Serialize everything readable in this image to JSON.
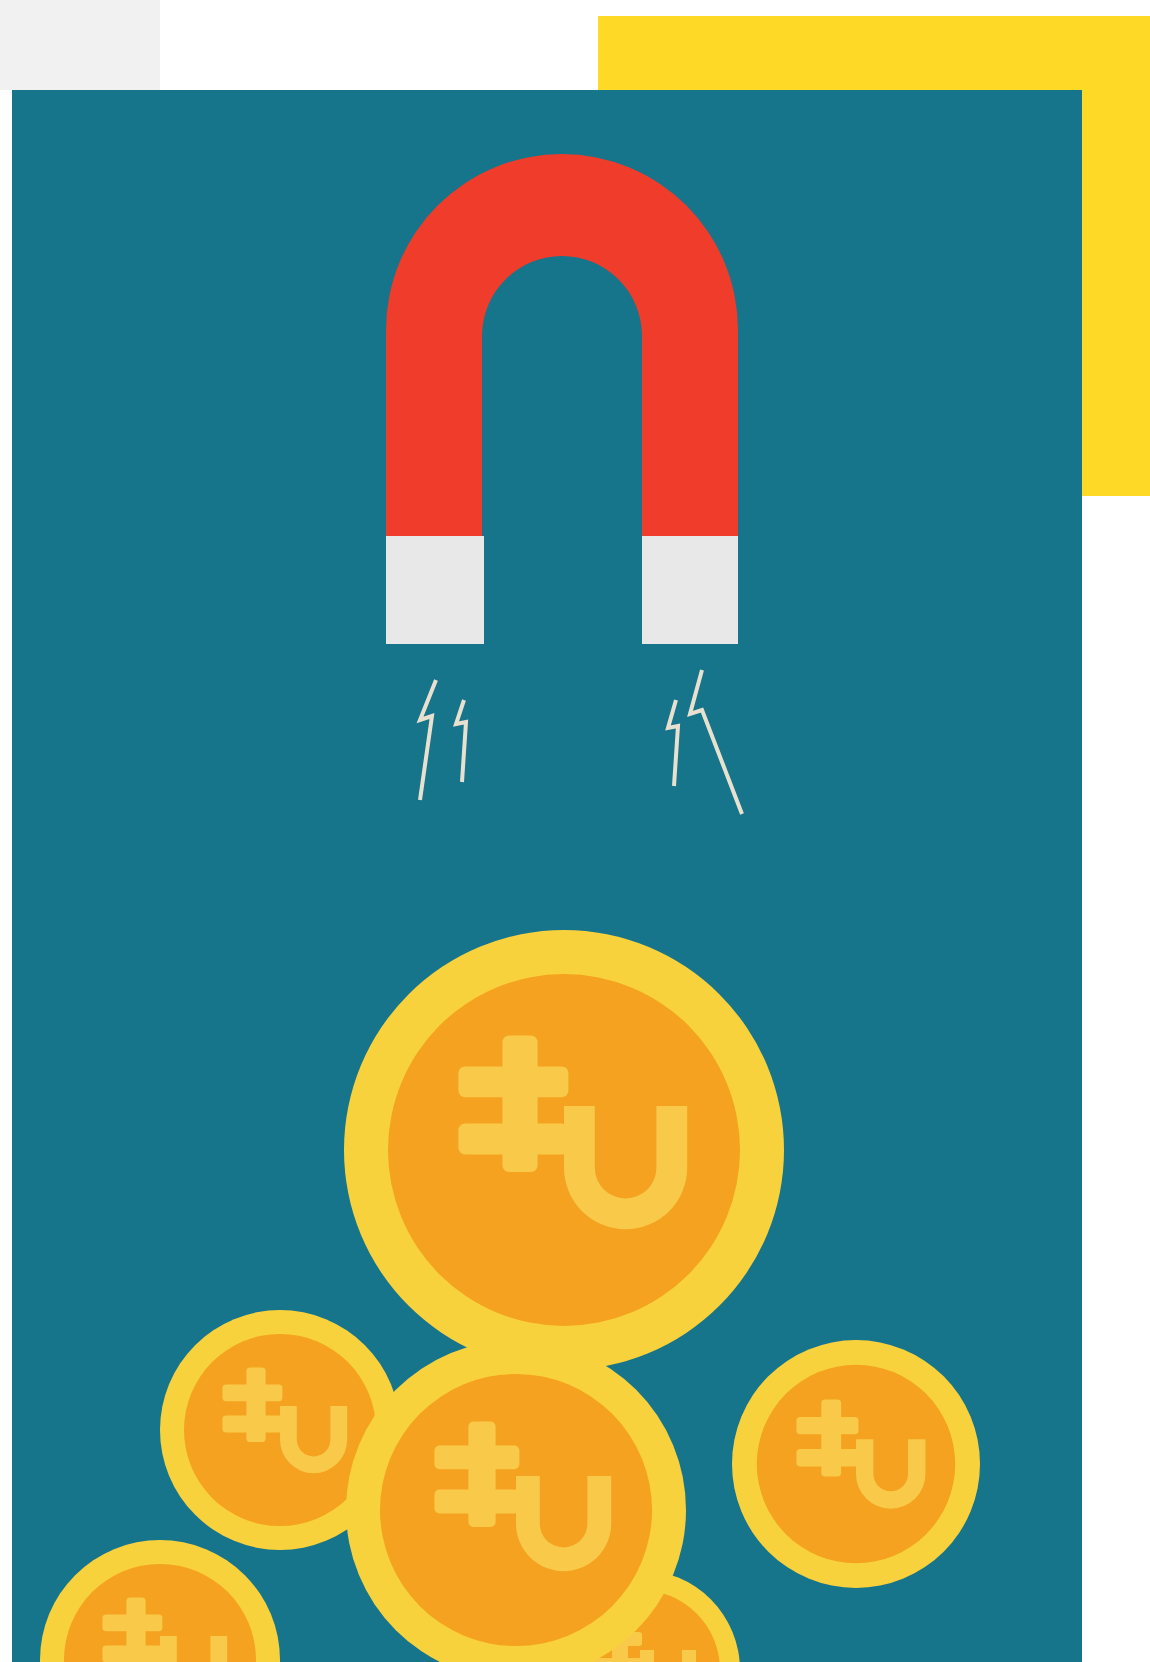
{
  "illustration": {
    "kind": "magnet_coins"
  }
}
